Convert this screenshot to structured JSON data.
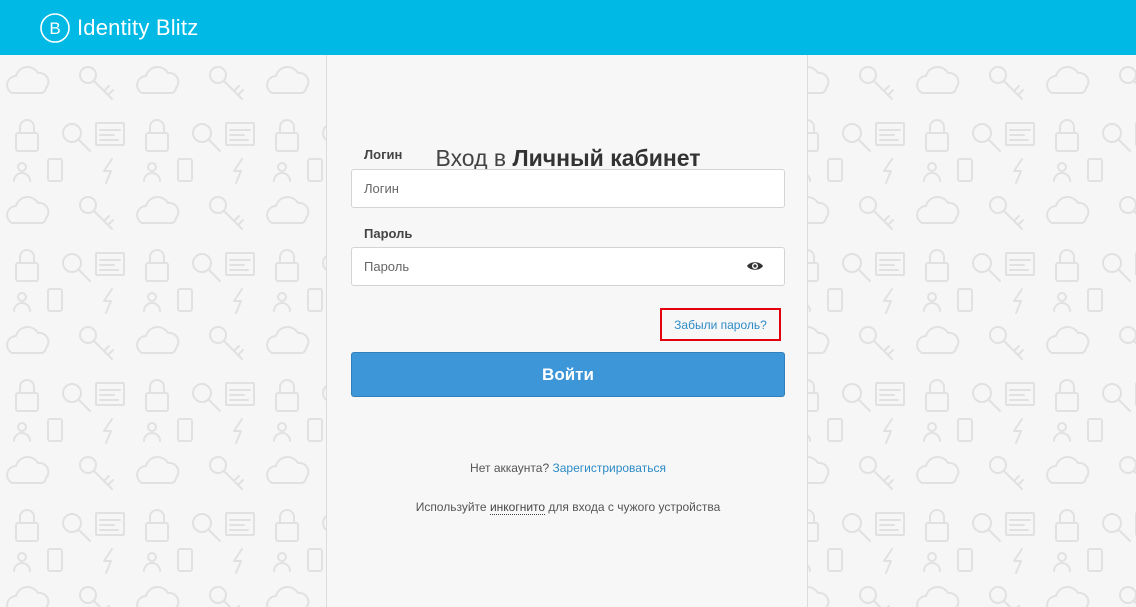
{
  "header": {
    "logo_text": "Identity Blitz",
    "logo_letter": "B",
    "background_color": "#00b9e4"
  },
  "login_card": {
    "title_prefix": "Вход в",
    "title_bold": "Личный кабинет",
    "login": {
      "label": "Логин",
      "placeholder": "Логин",
      "value": ""
    },
    "password": {
      "label": "Пароль",
      "placeholder": "Пароль",
      "value": "",
      "toggle_icon": "eye-icon"
    },
    "forgot_password_link": "Забыли пароль?",
    "submit_label": "Войти",
    "register": {
      "prompt": "Нет аккаунта?",
      "link": "Зарегистрироваться"
    },
    "incognito": {
      "before": "Используйте",
      "link": "инкогнито",
      "after": "для входа с чужого устройства"
    }
  },
  "colors": {
    "accent": "#3c96d7",
    "link": "#2d8bc7",
    "highlight_border": "#e3000f"
  }
}
